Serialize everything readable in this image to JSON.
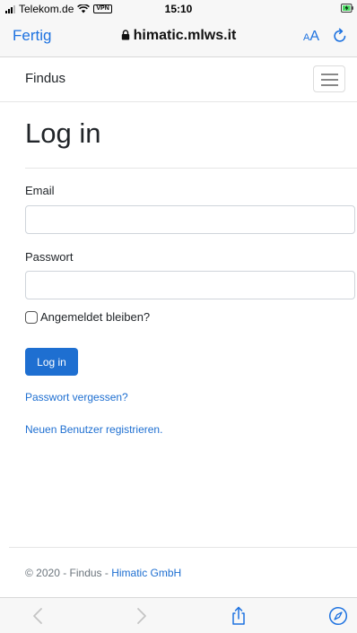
{
  "status_bar": {
    "carrier": "Telekom.de",
    "vpn": "VPN",
    "time": "15:10"
  },
  "safari": {
    "done": "Fertig",
    "url": "himatic.mlws.it",
    "aa_small": "A",
    "aa_large": "A"
  },
  "navbar": {
    "brand": "Findus"
  },
  "main": {
    "title": "Log in",
    "email_label": "Email",
    "email_value": "",
    "password_label": "Passwort",
    "password_value": "",
    "remember_label": "Angemeldet bleiben?",
    "login_button": "Log in",
    "forgot_link": "Passwort vergessen?",
    "register_link": "Neuen Benutzer registrieren."
  },
  "footer": {
    "text": "© 2020 - Findus - ",
    "link": "Himatic GmbH"
  },
  "icons": {
    "accent": "#1d72e0",
    "primary": "#1e6fd1"
  }
}
